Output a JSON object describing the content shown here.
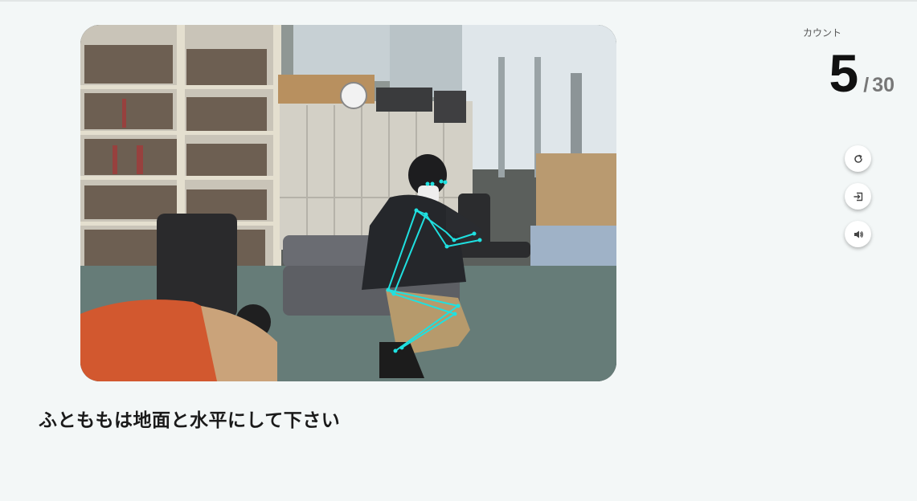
{
  "counter": {
    "label": "カウント",
    "current": "5",
    "separator": "/",
    "total": "30"
  },
  "instruction": "ふとももは地面と水平にして下さい",
  "controls": {
    "reset_icon": "reload-icon",
    "exit_icon": "exit-icon",
    "sound_icon": "speaker-icon"
  },
  "skeleton_color": "#1fe0e0"
}
